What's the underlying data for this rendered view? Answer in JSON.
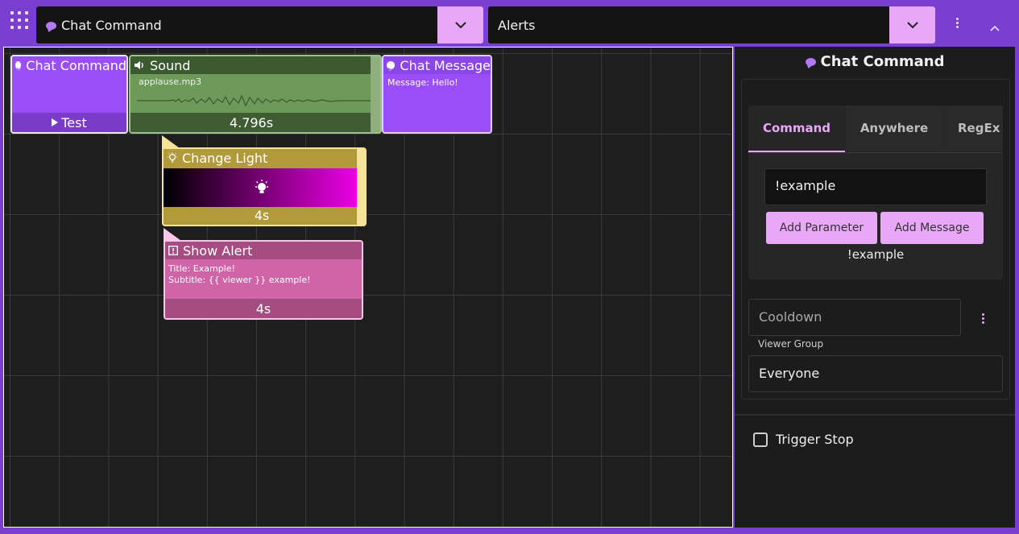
{
  "topbar": {
    "trigger_select": "Chat Command",
    "group_select": "Alerts"
  },
  "nodes": {
    "chat_command": {
      "title": "Chat Command",
      "action": "Test"
    },
    "sound": {
      "title": "Sound",
      "file": "applause.mp3",
      "duration": "4.796s"
    },
    "chat_message": {
      "title": "Chat Message",
      "detail": "Message: Hello!"
    },
    "change_light": {
      "title": "Change Light",
      "duration": "4s"
    },
    "show_alert": {
      "title": "Show Alert",
      "line1": "Title: Example!",
      "line2": "Subtitle: {{ viewer }} example!",
      "duration": "4s"
    }
  },
  "panel": {
    "title": "Chat Command",
    "tabs": [
      {
        "label": "Command",
        "active": true
      },
      {
        "label": "Anywhere",
        "active": false
      },
      {
        "label": "RegEx",
        "active": false
      }
    ],
    "command_value": "!example",
    "add_parameter": "Add Parameter",
    "add_message": "Add Message",
    "preview": "!example",
    "cooldown_placeholder": "Cooldown",
    "viewer_group_label": "Viewer Group",
    "viewer_group_value": "Everyone",
    "trigger_stop": "Trigger Stop"
  },
  "colors": {
    "accent": "#e9a8f7",
    "brand": "#7a3ed1",
    "chat_node": "#9a4ef7",
    "sound_node": "#6d9a59",
    "light_node": "#b19a3a",
    "alert_node": "#cf65a6"
  }
}
